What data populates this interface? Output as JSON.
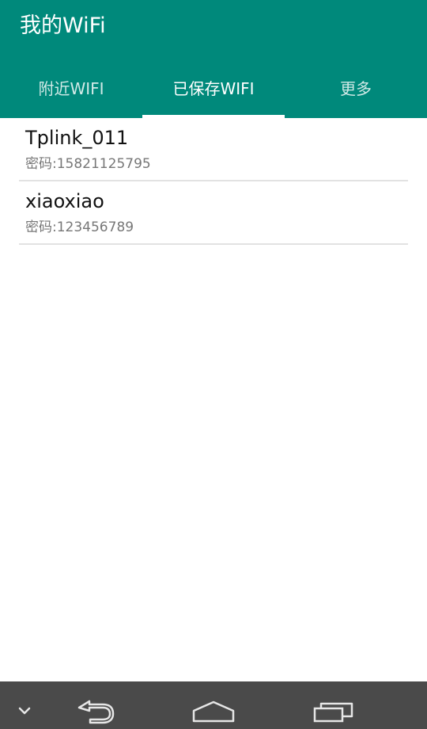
{
  "app_bar": {
    "title": "我的WiFi",
    "color": "#00897B"
  },
  "tabs": [
    {
      "label": "附近WIFI",
      "active": false
    },
    {
      "label": "已保存WIFI",
      "active": true
    },
    {
      "label": "更多",
      "active": false
    }
  ],
  "saved_wifi": [
    {
      "ssid": "Tplink_011",
      "password": "密码:15821125795"
    },
    {
      "ssid": "xiaoxiao",
      "password": "密码:123456789"
    }
  ],
  "nav_bar": {
    "icons": [
      "chevron-down-icon",
      "back-icon",
      "home-icon",
      "recent-apps-icon"
    ]
  }
}
